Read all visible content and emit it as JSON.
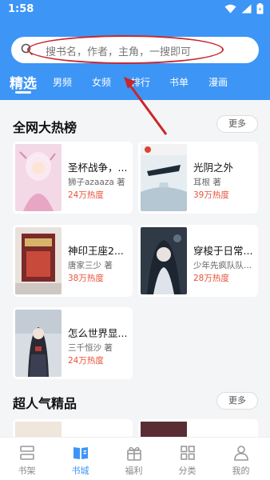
{
  "status_bar": {
    "time": "1:58"
  },
  "search": {
    "placeholder": "搜书名，作者，主角，一搜即可"
  },
  "category_tabs": [
    "精选",
    "男频",
    "女频",
    "排行",
    "书单",
    "漫画"
  ],
  "sections": [
    {
      "title": "全网大热榜",
      "more_label": "更多"
    },
    {
      "title": "超人气精品",
      "more_label": "更多"
    }
  ],
  "books": [
    {
      "title": "圣杯战争，...",
      "author": "狮子azaaza 著",
      "heat": "24万热度"
    },
    {
      "title": "光阴之外",
      "author": "耳根 著",
      "heat": "39万热度"
    },
    {
      "title": "神印王座2...",
      "author": "唐家三少 著",
      "heat": "38万热度"
    },
    {
      "title": "穿梭于日常...",
      "author": "少年先疯队队...",
      "heat": "28万热度"
    },
    {
      "title": "怎么世界显...",
      "author": "三千恒沙 著",
      "heat": "24万热度"
    }
  ],
  "bottom_nav": [
    "书架",
    "书城",
    "福利",
    "分类",
    "我的"
  ],
  "accent_color": "#3d95f6",
  "heat_color": "#e8533a",
  "annotation_color": "#c9272c"
}
